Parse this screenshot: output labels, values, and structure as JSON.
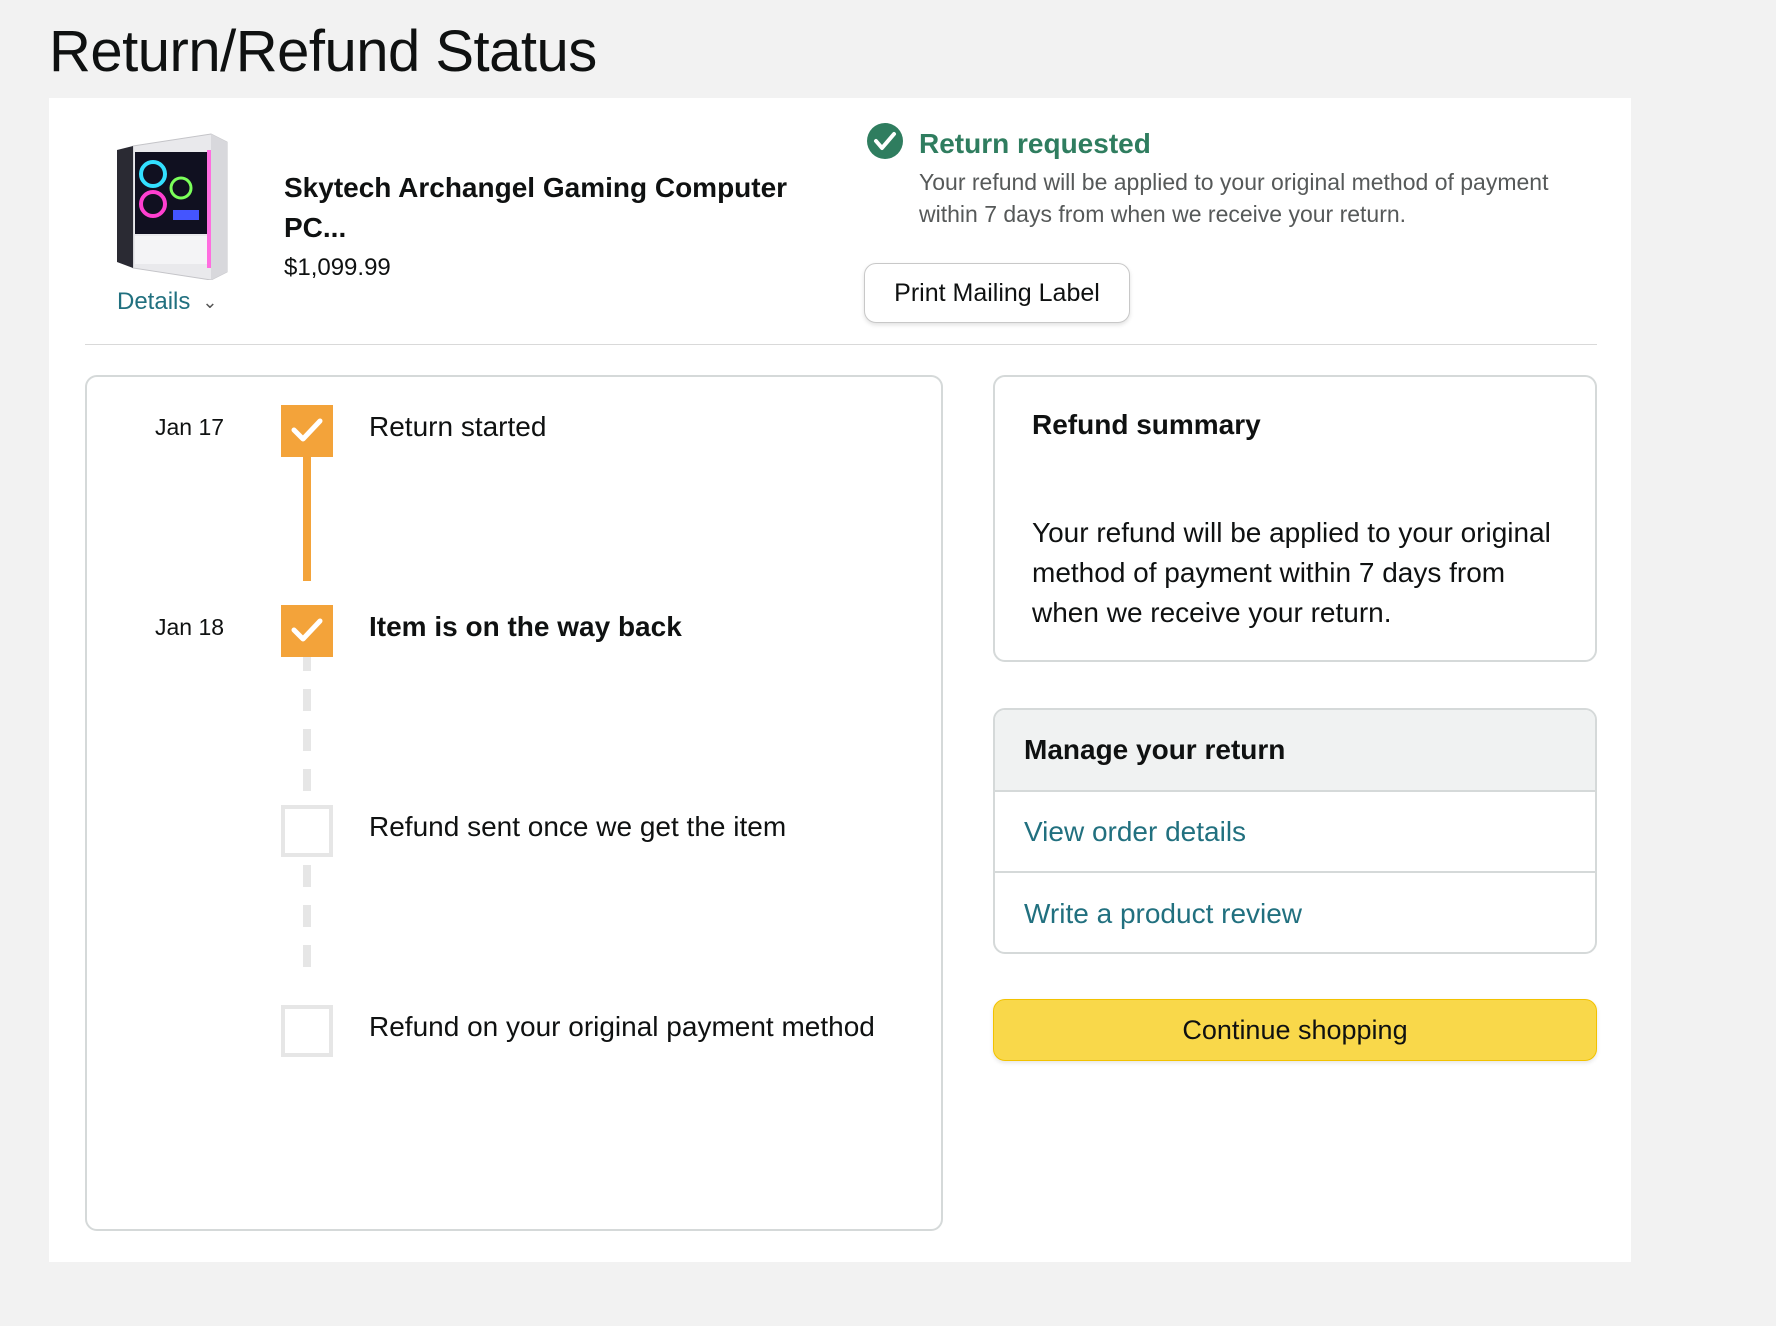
{
  "page": {
    "title": "Return/Refund Status"
  },
  "product": {
    "name": "Skytech Archangel Gaming Computer PC...",
    "price": "$1,099.99",
    "details_label": "Details",
    "image_icon": "gaming-pc-tower-image"
  },
  "status": {
    "title": "Return requested",
    "description": "Your refund will be applied to your original method of payment within 7 days from when we receive your return.",
    "color": "#2f7d5f",
    "icon": "check-circle-icon"
  },
  "print_label_button": "Print Mailing Label",
  "timeline": {
    "accent_color": "#f3a33a",
    "steps": [
      {
        "date": "Jan 17",
        "label": "Return started",
        "done": true
      },
      {
        "date": "Jan 18",
        "label": "Item is on the way back",
        "done": true
      },
      {
        "date": "",
        "label": "Refund sent once we get the item",
        "done": false
      },
      {
        "date": "",
        "label": "Refund on your original payment method",
        "done": false
      }
    ]
  },
  "refund_summary": {
    "title": "Refund summary",
    "text": "Your refund will be applied to your original method of payment within 7 days from when we receive your return."
  },
  "manage": {
    "title": "Manage your return",
    "links": [
      "View order details",
      "Write a product review"
    ],
    "link_color": "#21707f"
  },
  "continue_button": {
    "label": "Continue shopping",
    "color": "#f9d84a"
  }
}
